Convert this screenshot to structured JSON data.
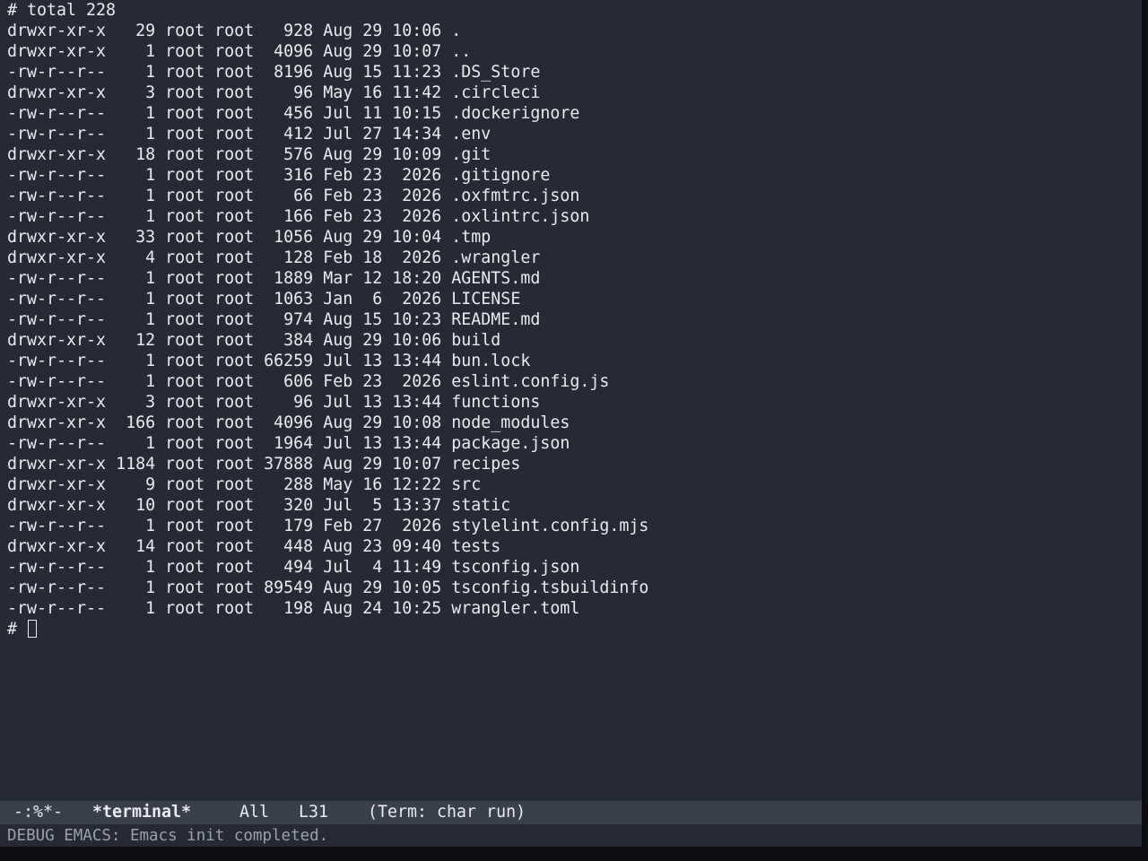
{
  "terminal": {
    "header": "# total 228",
    "entries": [
      {
        "perms": "drwxr-xr-x",
        "links": "29",
        "owner": "root",
        "group": "root",
        "size": "928",
        "date": "Aug 29 10:06",
        "name": "."
      },
      {
        "perms": "drwxr-xr-x",
        "links": "1",
        "owner": "root",
        "group": "root",
        "size": "4096",
        "date": "Aug 29 10:07",
        "name": ".."
      },
      {
        "perms": "-rw-r--r--",
        "links": "1",
        "owner": "root",
        "group": "root",
        "size": "8196",
        "date": "Aug 15 11:23",
        "name": ".DS_Store"
      },
      {
        "perms": "drwxr-xr-x",
        "links": "3",
        "owner": "root",
        "group": "root",
        "size": "96",
        "date": "May 16 11:42",
        "name": ".circleci"
      },
      {
        "perms": "-rw-r--r--",
        "links": "1",
        "owner": "root",
        "group": "root",
        "size": "456",
        "date": "Jul 11 10:15",
        "name": ".dockerignore"
      },
      {
        "perms": "-rw-r--r--",
        "links": "1",
        "owner": "root",
        "group": "root",
        "size": "412",
        "date": "Jul 27 14:34",
        "name": ".env"
      },
      {
        "perms": "drwxr-xr-x",
        "links": "18",
        "owner": "root",
        "group": "root",
        "size": "576",
        "date": "Aug 29 10:09",
        "name": ".git"
      },
      {
        "perms": "-rw-r--r--",
        "links": "1",
        "owner": "root",
        "group": "root",
        "size": "316",
        "date": "Feb 23  2026",
        "name": ".gitignore"
      },
      {
        "perms": "-rw-r--r--",
        "links": "1",
        "owner": "root",
        "group": "root",
        "size": "66",
        "date": "Feb 23  2026",
        "name": ".oxfmtrc.json"
      },
      {
        "perms": "-rw-r--r--",
        "links": "1",
        "owner": "root",
        "group": "root",
        "size": "166",
        "date": "Feb 23  2026",
        "name": ".oxlintrc.json"
      },
      {
        "perms": "drwxr-xr-x",
        "links": "33",
        "owner": "root",
        "group": "root",
        "size": "1056",
        "date": "Aug 29 10:04",
        "name": ".tmp"
      },
      {
        "perms": "drwxr-xr-x",
        "links": "4",
        "owner": "root",
        "group": "root",
        "size": "128",
        "date": "Feb 18  2026",
        "name": ".wrangler"
      },
      {
        "perms": "-rw-r--r--",
        "links": "1",
        "owner": "root",
        "group": "root",
        "size": "1889",
        "date": "Mar 12 18:20",
        "name": "AGENTS.md"
      },
      {
        "perms": "-rw-r--r--",
        "links": "1",
        "owner": "root",
        "group": "root",
        "size": "1063",
        "date": "Jan  6  2026",
        "name": "LICENSE"
      },
      {
        "perms": "-rw-r--r--",
        "links": "1",
        "owner": "root",
        "group": "root",
        "size": "974",
        "date": "Aug 15 10:23",
        "name": "README.md"
      },
      {
        "perms": "drwxr-xr-x",
        "links": "12",
        "owner": "root",
        "group": "root",
        "size": "384",
        "date": "Aug 29 10:06",
        "name": "build"
      },
      {
        "perms": "-rw-r--r--",
        "links": "1",
        "owner": "root",
        "group": "root",
        "size": "66259",
        "date": "Jul 13 13:44",
        "name": "bun.lock"
      },
      {
        "perms": "-rw-r--r--",
        "links": "1",
        "owner": "root",
        "group": "root",
        "size": "606",
        "date": "Feb 23  2026",
        "name": "eslint.config.js"
      },
      {
        "perms": "drwxr-xr-x",
        "links": "3",
        "owner": "root",
        "group": "root",
        "size": "96",
        "date": "Jul 13 13:44",
        "name": "functions"
      },
      {
        "perms": "drwxr-xr-x",
        "links": "166",
        "owner": "root",
        "group": "root",
        "size": "4096",
        "date": "Aug 29 10:08",
        "name": "node_modules"
      },
      {
        "perms": "-rw-r--r--",
        "links": "1",
        "owner": "root",
        "group": "root",
        "size": "1964",
        "date": "Jul 13 13:44",
        "name": "package.json"
      },
      {
        "perms": "drwxr-xr-x",
        "links": "1184",
        "owner": "root",
        "group": "root",
        "size": "37888",
        "date": "Aug 29 10:07",
        "name": "recipes"
      },
      {
        "perms": "drwxr-xr-x",
        "links": "9",
        "owner": "root",
        "group": "root",
        "size": "288",
        "date": "May 16 12:22",
        "name": "src"
      },
      {
        "perms": "drwxr-xr-x",
        "links": "10",
        "owner": "root",
        "group": "root",
        "size": "320",
        "date": "Jul  5 13:37",
        "name": "static"
      },
      {
        "perms": "-rw-r--r--",
        "links": "1",
        "owner": "root",
        "group": "root",
        "size": "179",
        "date": "Feb 27  2026",
        "name": "stylelint.config.mjs"
      },
      {
        "perms": "drwxr-xr-x",
        "links": "14",
        "owner": "root",
        "group": "root",
        "size": "448",
        "date": "Aug 23 09:40",
        "name": "tests"
      },
      {
        "perms": "-rw-r--r--",
        "links": "1",
        "owner": "root",
        "group": "root",
        "size": "494",
        "date": "Jul  4 11:49",
        "name": "tsconfig.json"
      },
      {
        "perms": "-rw-r--r--",
        "links": "1",
        "owner": "root",
        "group": "root",
        "size": "89549",
        "date": "Aug 29 10:05",
        "name": "tsconfig.tsbuildinfo"
      },
      {
        "perms": "-rw-r--r--",
        "links": "1",
        "owner": "root",
        "group": "root",
        "size": "198",
        "date": "Aug 24 10:25",
        "name": "wrangler.toml"
      }
    ],
    "prompt": "# "
  },
  "mode_line": {
    "status": "-:%*-",
    "buffer_name": "*terminal*",
    "position": "All",
    "line": "L31",
    "mode": "(Term: char run)"
  },
  "echo_area": {
    "message": "DEBUG EMACS: Emacs init completed."
  }
}
